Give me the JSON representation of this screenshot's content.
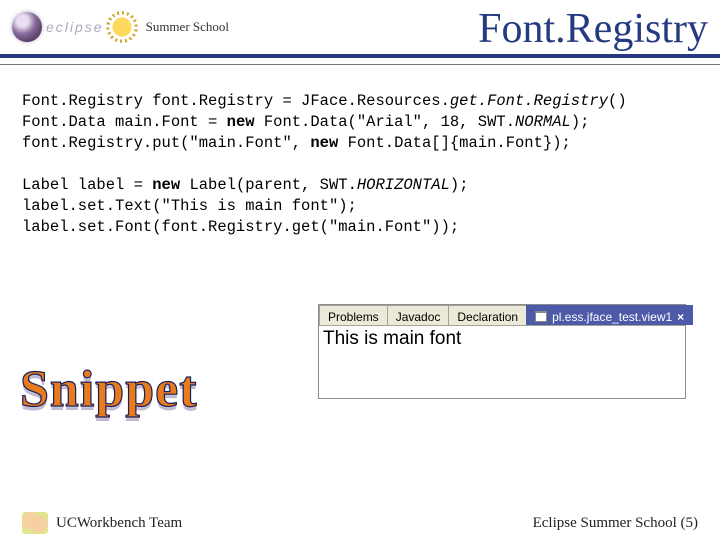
{
  "header": {
    "logo_text": "eclipse",
    "summer_school": "Summer School",
    "title": "Font.Registry"
  },
  "code": {
    "l1a": "Font.Registry font.Registry = JFace.Resources.",
    "l1b": "get.Font.Registry",
    "l1c": "()",
    "l2a": "Font.Data main.Font = ",
    "l2b": "new",
    "l2c": " Font.Data(\"Arial\", 18, SWT.",
    "l2d": "NORMAL",
    "l2e": ");",
    "l3a": "font.Registry.put(\"main.Font\", ",
    "l3b": "new",
    "l3c": " Font.Data[]{main.Font});",
    "l4": "",
    "l5a": "Label label = ",
    "l5b": "new",
    "l5c": " Label(parent, SWT.",
    "l5d": "HORIZONTAL",
    "l5e": ");",
    "l6": "label.set.Text(\"This is main font\");",
    "l7": "label.set.Font(font.Registry.get(\"main.Font\"));"
  },
  "panel": {
    "tabs": {
      "t0": "Problems",
      "t1": "Javadoc",
      "t2": "Declaration",
      "active": "pl.ess.jface_test.view1"
    },
    "close": "×",
    "body": "This is main font"
  },
  "snippet": "Snippet",
  "footer": {
    "left": "UCWorkbench Team",
    "right": "Eclipse Summer School (5)"
  }
}
